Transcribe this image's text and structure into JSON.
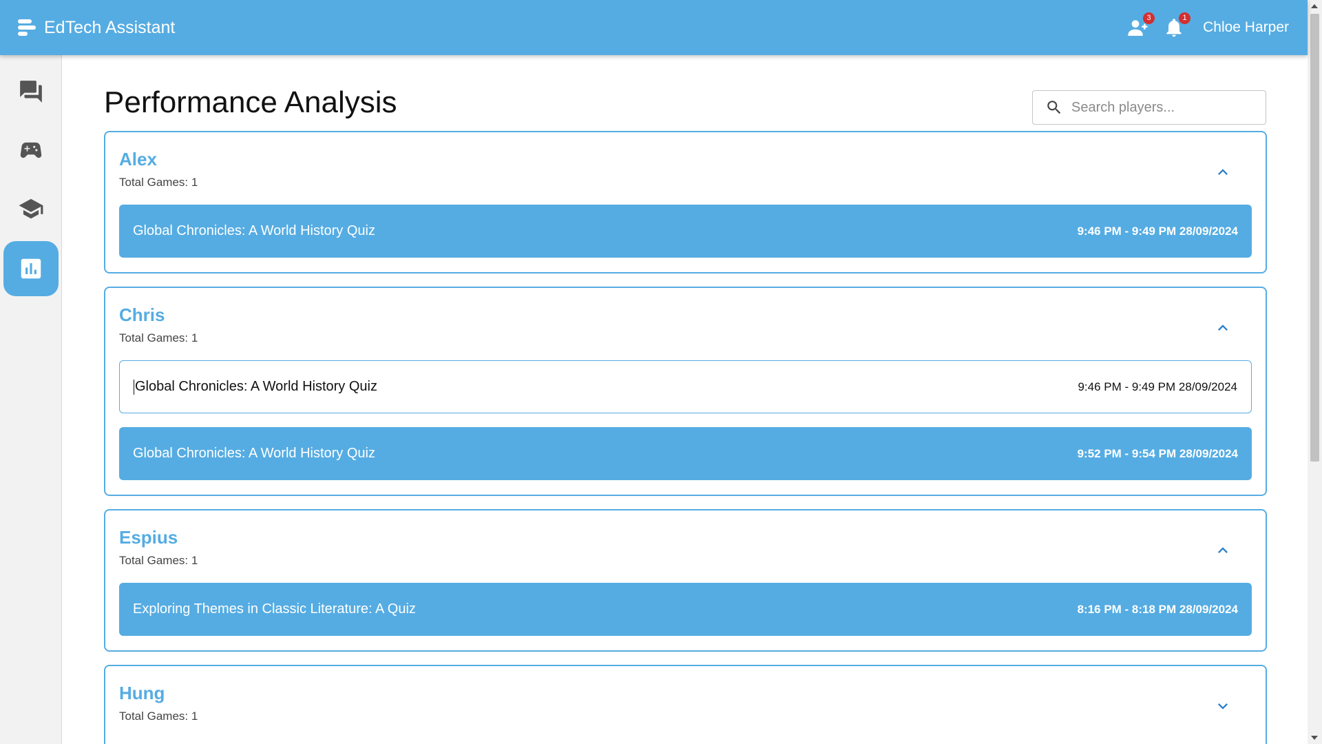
{
  "app": {
    "title": "EdTech Assistant",
    "user_name": "Chloe Harper",
    "friends_badge": "3",
    "notifications_badge": "1"
  },
  "sidebar": {
    "items": [
      {
        "icon": "chat-icon",
        "active": false
      },
      {
        "icon": "gamepad-icon",
        "active": false
      },
      {
        "icon": "graduation-cap-icon",
        "active": false
      },
      {
        "icon": "bar-chart-icon",
        "active": true
      }
    ]
  },
  "page": {
    "title": "Performance Analysis",
    "search_placeholder": "Search players..."
  },
  "total_games_label": "Total Games: 1",
  "players": [
    {
      "name": "Alex",
      "total_games": "Total Games: 1",
      "expanded": true,
      "sessions": [
        {
          "title": "Global Chronicles: A World History Quiz",
          "time": "9:46 PM - 9:49 PM 28/09/2024",
          "style": "filled"
        }
      ]
    },
    {
      "name": "Chris",
      "total_games": "Total Games: 1",
      "expanded": true,
      "sessions": [
        {
          "title": "Global Chronicles: A World History Quiz",
          "time": "9:46 PM - 9:49 PM 28/09/2024",
          "style": "outline"
        },
        {
          "title": "Global Chronicles: A World History Quiz",
          "time": "9:52 PM - 9:54 PM 28/09/2024",
          "style": "filled"
        }
      ]
    },
    {
      "name": "Espius",
      "total_games": "Total Games: 1",
      "expanded": true,
      "sessions": [
        {
          "title": "Exploring Themes in Classic Literature: A Quiz",
          "time": "8:16 PM - 8:18 PM 28/09/2024",
          "style": "filled"
        }
      ]
    },
    {
      "name": "Hung",
      "total_games": "Total Games: 1",
      "expanded": false,
      "sessions": []
    }
  ],
  "colors": {
    "accent": "#55ace2",
    "badge": "#d32f2f",
    "sidebar_bg": "#f2f2f2"
  }
}
